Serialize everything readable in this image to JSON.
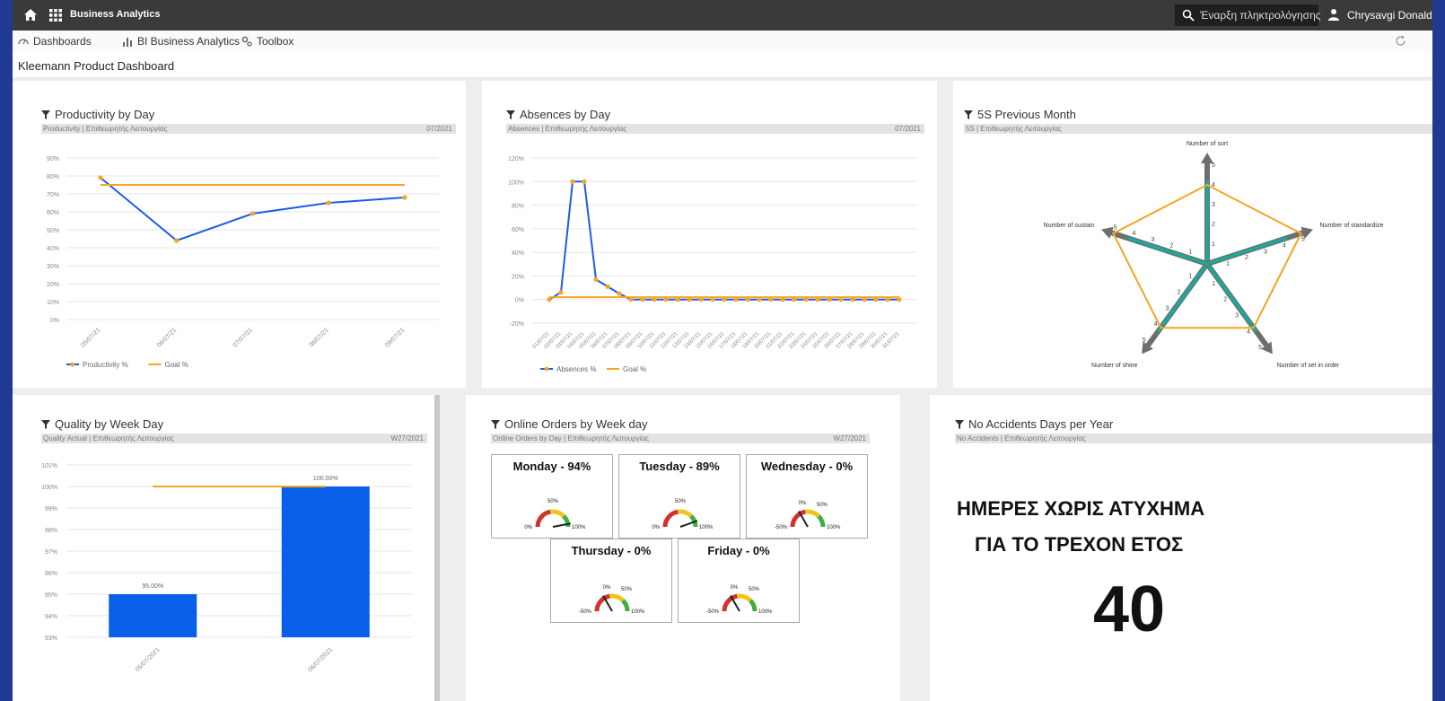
{
  "app": {
    "brand": "Business Analytics"
  },
  "search": {
    "placeholder": "Έναρξη πληκτρολόγησης"
  },
  "user": {
    "name": "Chrysavgi Donaldsi"
  },
  "nav": {
    "dashboards": "Dashboards",
    "bi": "BI Business Analytics",
    "toolbox": "Toolbox"
  },
  "page": {
    "title": "Kleemann Product Dashboard"
  },
  "colors": {
    "series_blue": "#1e5ce6",
    "goal_orange": "#f5a623",
    "bar_blue": "#0a5fe8",
    "radar_teal": "#1aa99a",
    "axis_gray": "#6e6e6e"
  },
  "cards": {
    "productivity": {
      "title": "Productivity by Day",
      "sub_left": "Productivity | Επιθεωρητής Λειτουργίας",
      "sub_right": "07/2021"
    },
    "absences": {
      "title": "Absences by Day",
      "sub_left": "Absences | Επιθεωρητής Λειτουργίας",
      "sub_right": "07/2021"
    },
    "fives": {
      "title": "5S Previous Month",
      "sub_left": "5S | Επιθεωρητής Λειτουργίας",
      "sub_right": ""
    },
    "quality": {
      "title": "Quality by Week Day",
      "sub_left": "Quality Actual | Επιθεωρητής Λειτουργίας",
      "sub_right": "W27/2021"
    },
    "orders": {
      "title": "Online Orders by Week day",
      "sub_left": "Online Orders by Day | Επιθεωρητής Λειτουργίας",
      "sub_right": "W27/2021"
    },
    "accidents": {
      "title": "No Accidents Days per Year",
      "sub_left": "No Accidents | Επιθεωρητής Λειτουργίας",
      "sub_right": ""
    }
  },
  "gauges": [
    {
      "label": "Monday - 94%",
      "value": 94,
      "min_label": "0%",
      "mid_label": "50%",
      "max_label": "100%"
    },
    {
      "label": "Tuesday - 89%",
      "value": 89,
      "min_label": "0%",
      "mid_label": "50%",
      "max_label": "100%"
    },
    {
      "label": "Wednesday - 0%",
      "value": 0,
      "min_label": "-50%",
      "mid_label": "50%",
      "zero_label": "0%",
      "max_label": "100%"
    },
    {
      "label": "Thursday - 0%",
      "value": 0,
      "min_label": "-50%",
      "mid_label": "50%",
      "zero_label": "0%",
      "max_label": "100%"
    },
    {
      "label": "Friday - 0%",
      "value": 0,
      "min_label": "-50%",
      "mid_label": "50%",
      "zero_label": "0%",
      "max_label": "100%"
    }
  ],
  "accidents": {
    "line1": "ΗΜΕΡΕΣ ΧΩΡΙΣ ΑΤΥΧΗΜΑ",
    "line2": "ΓΙΑ ΤΟ ΤΡΕΧΟΝ ΕΤΟΣ",
    "value": "40"
  },
  "chart_data": [
    {
      "type": "line",
      "title": "Productivity by Day",
      "x": [
        "05/07/21",
        "06/07/21",
        "07/07/21",
        "08/07/21",
        "09/07/21"
      ],
      "series": [
        {
          "name": "Productivity %",
          "values": [
            79,
            44,
            59,
            65,
            68
          ]
        },
        {
          "name": "Goal %",
          "values": [
            75,
            75,
            75,
            75,
            75
          ]
        }
      ],
      "yticks": [
        "0%",
        "10%",
        "20%",
        "30%",
        "40%",
        "50%",
        "60%",
        "70%",
        "80%",
        "90%"
      ],
      "ylim": [
        0,
        90
      ],
      "grid": true,
      "legend": "bottom"
    },
    {
      "type": "line",
      "title": "Absences by Day",
      "x": [
        "01/07/21",
        "02/07/21",
        "03/07/21",
        "04/07/21",
        "05/07/21",
        "06/07/21",
        "07/07/21",
        "08/07/21",
        "09/07/21",
        "10/07/21",
        "11/07/21",
        "12/07/21",
        "13/07/21",
        "14/07/21",
        "15/07/21",
        "16/07/21",
        "17/07/21",
        "18/07/21",
        "19/07/21",
        "20/07/21",
        "21/07/21",
        "22/07/21",
        "23/07/21",
        "24/07/21",
        "25/07/21",
        "26/07/21",
        "27/07/21",
        "28/07/21",
        "29/07/21",
        "30/07/21",
        "31/07/21"
      ],
      "series": [
        {
          "name": "Absences %",
          "values": [
            0,
            6,
            100,
            100,
            17,
            11,
            5,
            0,
            0,
            0,
            0,
            0,
            0,
            0,
            0,
            0,
            0,
            0,
            0,
            0,
            0,
            0,
            0,
            0,
            0,
            0,
            0,
            0,
            0,
            0,
            0
          ]
        },
        {
          "name": "Goal %",
          "values": [
            2,
            2,
            2,
            2,
            2,
            2,
            2,
            2,
            2,
            2,
            2,
            2,
            2,
            2,
            2,
            2,
            2,
            2,
            2,
            2,
            2,
            2,
            2,
            2,
            2,
            2,
            2,
            2,
            2,
            2,
            2
          ]
        }
      ],
      "yticks": [
        "-20%",
        "0%",
        "20%",
        "40%",
        "60%",
        "80%",
        "100%",
        "120%"
      ],
      "ylim": [
        -20,
        120
      ],
      "grid": true,
      "legend": "bottom"
    },
    {
      "type": "radar",
      "title": "5S Previous Month",
      "axes": [
        "Number of sort",
        "Number of standardize",
        "Number of set in order",
        "Number of shine",
        "Number of sustain"
      ],
      "rmax": 5,
      "ticks": [
        "1",
        "2",
        "3",
        "4",
        "5"
      ],
      "series": [
        {
          "name": "",
          "values": [
            4,
            5,
            4,
            4,
            5
          ]
        }
      ]
    },
    {
      "type": "bar",
      "title": "Quality by Week Day",
      "categories": [
        "05/07/2021",
        "06/07/2021"
      ],
      "values": [
        95.0,
        100.0
      ],
      "data_labels": [
        "95.00%",
        "100.00%"
      ],
      "goal": 100,
      "yticks": [
        "93%",
        "94%",
        "95%",
        "96%",
        "97%",
        "98%",
        "99%",
        "100%",
        "101%"
      ],
      "ylim": [
        93,
        101
      ],
      "grid": true
    }
  ]
}
